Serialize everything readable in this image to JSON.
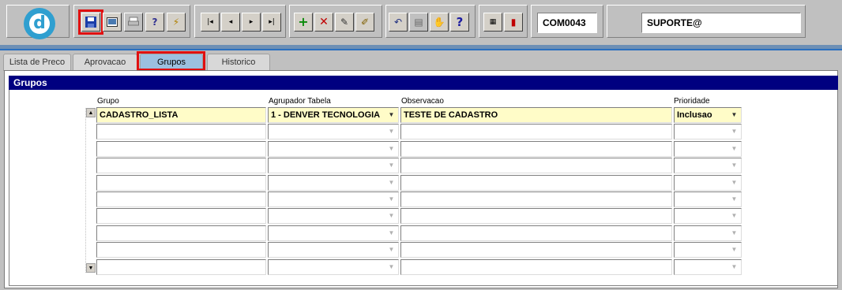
{
  "toolbar": {
    "logo_letter": "d",
    "record_code": "COM0043",
    "user": "SUPORTE@",
    "icons": [
      "save-icon",
      "window-icon",
      "print-icon",
      "query-icon",
      "execute-icon",
      "first-record-icon",
      "previous-record-icon",
      "next-record-icon",
      "last-record-icon",
      "insert-record-icon",
      "delete-record-icon",
      "edit-icon",
      "clear-icon",
      "undo-icon",
      "clipboard-icon",
      "tools-icon",
      "help-icon",
      "menu-icon",
      "exit-icon"
    ]
  },
  "tabs": [
    {
      "label": "Lista de Preco"
    },
    {
      "label": "Aprovacao"
    },
    {
      "label": "Grupos",
      "active": true
    },
    {
      "label": "Historico"
    }
  ],
  "block": {
    "title": "Grupos",
    "headers": {
      "grupo": "Grupo",
      "agrupador": "Agrupador Tabela",
      "observacao": "Observacao",
      "prioridade": "Prioridade"
    },
    "rows": [
      {
        "grupo": "CADASTRO_LISTA",
        "agrupador": "1 - DENVER TECNOLOGIA",
        "observacao": "TESTE DE CADASTRO",
        "prioridade": "Inclusao"
      },
      {
        "grupo": "",
        "agrupador": "",
        "observacao": "",
        "prioridade": ""
      },
      {
        "grupo": "",
        "agrupador": "",
        "observacao": "",
        "prioridade": ""
      },
      {
        "grupo": "",
        "agrupador": "",
        "observacao": "",
        "prioridade": ""
      },
      {
        "grupo": "",
        "agrupador": "",
        "observacao": "",
        "prioridade": ""
      },
      {
        "grupo": "",
        "agrupador": "",
        "observacao": "",
        "prioridade": ""
      },
      {
        "grupo": "",
        "agrupador": "",
        "observacao": "",
        "prioridade": ""
      },
      {
        "grupo": "",
        "agrupador": "",
        "observacao": "",
        "prioridade": ""
      },
      {
        "grupo": "",
        "agrupador": "",
        "observacao": "",
        "prioridade": ""
      },
      {
        "grupo": "",
        "agrupador": "",
        "observacao": "",
        "prioridade": ""
      }
    ]
  },
  "colors": {
    "block_title_bg": "#000080",
    "filled_cell_bg": "#fffcc8",
    "highlight": "#e01010",
    "active_tab_bg": "#9cc0df"
  }
}
